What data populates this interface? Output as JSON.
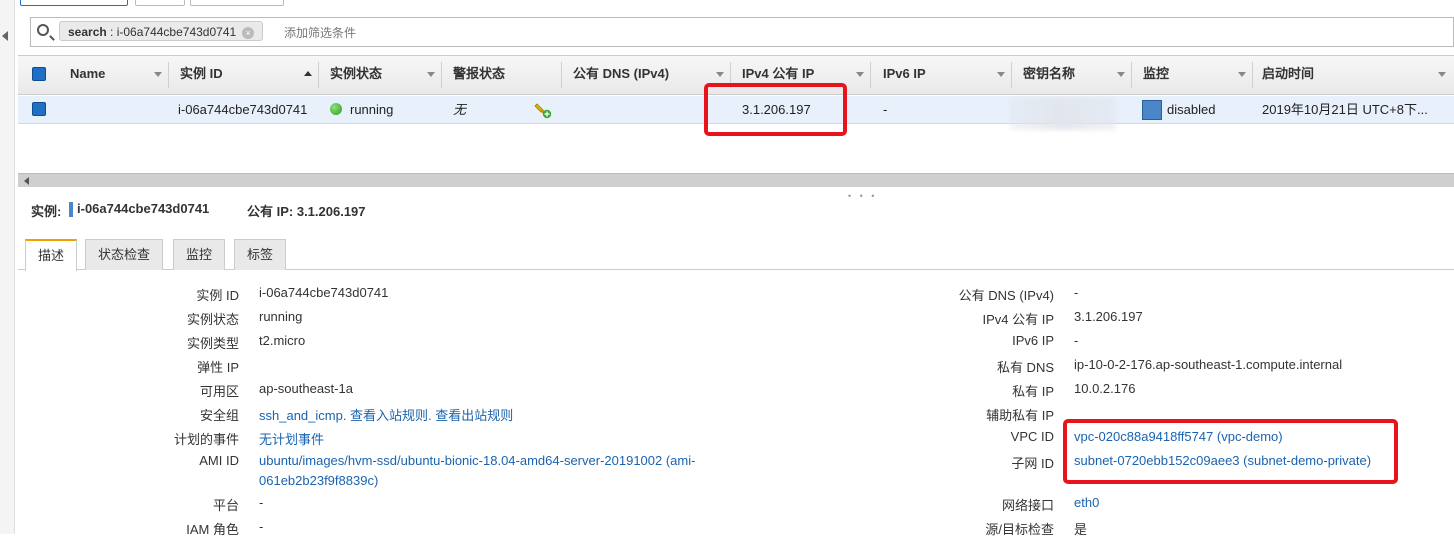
{
  "search": {
    "token_key": "search",
    "token_value": "i-06a744cbe743d0741",
    "token_close": "×",
    "placeholder": "添加筛选条件"
  },
  "table": {
    "columns": [
      "Name",
      "实例 ID",
      "实例状态",
      "警报状态",
      "公有 DNS (IPv4)",
      "IPv4 公有 IP",
      "IPv6 IP",
      "密钥名称",
      "监控",
      "启动时间"
    ],
    "row": {
      "name": "",
      "instance_id": "i-06a744cbe743d0741",
      "state": "running",
      "alarm": "无",
      "public_dns": "",
      "ipv4": "3.1.206.197",
      "ipv6": "-",
      "monitoring": "disabled",
      "launch_time": "2019年10月21日 UTC+8下..."
    }
  },
  "detail": {
    "instance_label": "实例:",
    "instance_id": "i-06a744cbe743d0741",
    "public_ip_label": "公有 IP: 3.1.206.197",
    "tabs": [
      "描述",
      "状态检查",
      "监控",
      "标签"
    ],
    "left": [
      {
        "k": "实例 ID",
        "v": "i-06a744cbe743d0741"
      },
      {
        "k": "实例状态",
        "v": "running"
      },
      {
        "k": "实例类型",
        "v": "t2.micro"
      },
      {
        "k": "弹性 IP",
        "v": ""
      },
      {
        "k": "可用区",
        "v": "ap-southeast-1a"
      },
      {
        "k": "安全组",
        "v1": "ssh_and_icmp",
        "v2": ". 查看入站规则",
        "v3": ". 查看出站规则"
      },
      {
        "k": "计划的事件",
        "v": "无计划事件"
      },
      {
        "k": "AMI ID",
        "v": "ubuntu/images/hvm-ssd/ubuntu-bionic-18.04-amd64-server-20191002 (ami-",
        "v_cont": "061eb2b23f9f8839c)"
      },
      {
        "k": "平台",
        "v": "-"
      },
      {
        "k": "IAM 角色",
        "v": "-"
      }
    ],
    "right": [
      {
        "k": "公有 DNS (IPv4)",
        "v": "-"
      },
      {
        "k": "IPv4 公有 IP",
        "v": "3.1.206.197"
      },
      {
        "k": "IPv6 IP",
        "v": "-"
      },
      {
        "k": "私有 DNS",
        "v": "ip-10-0-2-176.ap-southeast-1.compute.internal"
      },
      {
        "k": "私有 IP",
        "v": "10.0.2.176"
      },
      {
        "k": "辅助私有 IP",
        "v": ""
      },
      {
        "k": "VPC ID",
        "v": "vpc-020c88a9418ff5747 (vpc-demo)"
      },
      {
        "k": "子网 ID",
        "v": "subnet-0720ebb152c09aee3 (subnet-demo-private)"
      },
      {
        "k": "网络接口",
        "v": "eth0"
      },
      {
        "k": "源/目标检查",
        "v": "是"
      }
    ]
  },
  "colors": {
    "accent": "#1f6fc4",
    "link": "#1a63b0",
    "highlight": "#e8141c",
    "tab_active": "#f0a000"
  }
}
